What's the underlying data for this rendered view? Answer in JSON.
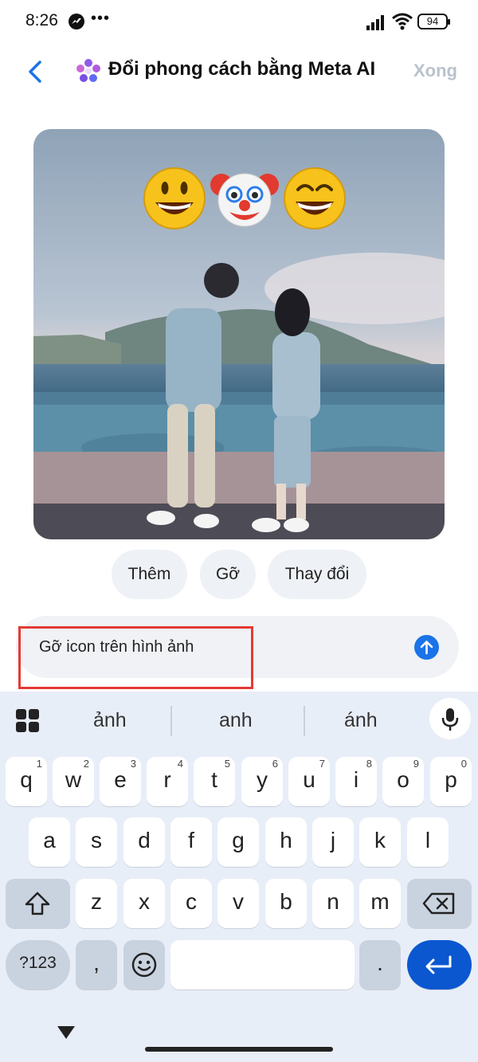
{
  "status_bar": {
    "time": "8:26",
    "battery": "94"
  },
  "header": {
    "title": "Đổi phong cách bằng Meta AI",
    "done_label": "Xong"
  },
  "photo": {
    "emojis": [
      "😃",
      "🤡",
      "😄"
    ]
  },
  "chips": [
    "Thêm",
    "Gỡ",
    "Thay đổi"
  ],
  "composer": {
    "text": "Gỡ icon trên hình ảnh"
  },
  "keyboard": {
    "suggestions": [
      "ảnh",
      "anh",
      "ánh"
    ],
    "row1": [
      {
        "key": "q",
        "num": "1"
      },
      {
        "key": "w",
        "num": "2"
      },
      {
        "key": "e",
        "num": "3"
      },
      {
        "key": "r",
        "num": "4"
      },
      {
        "key": "t",
        "num": "5"
      },
      {
        "key": "y",
        "num": "6"
      },
      {
        "key": "u",
        "num": "7"
      },
      {
        "key": "i",
        "num": "8"
      },
      {
        "key": "o",
        "num": "9"
      },
      {
        "key": "p",
        "num": "0"
      }
    ],
    "row2": [
      "a",
      "s",
      "d",
      "f",
      "g",
      "h",
      "j",
      "k",
      "l"
    ],
    "row3": [
      "z",
      "x",
      "c",
      "v",
      "b",
      "n",
      "m"
    ],
    "symbols_label": "?123",
    "comma": ",",
    "period": "."
  }
}
